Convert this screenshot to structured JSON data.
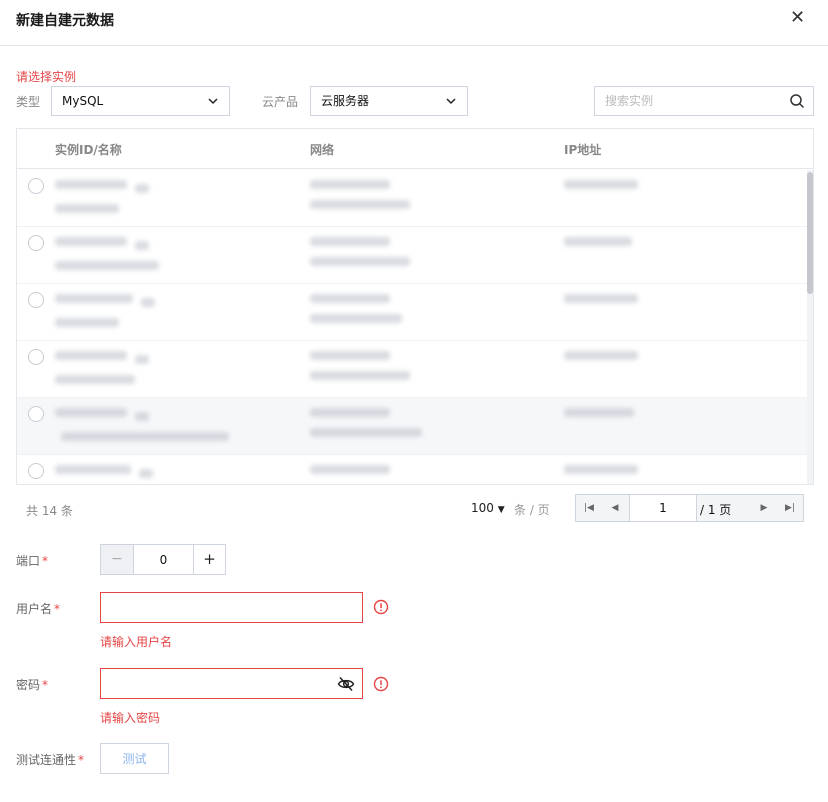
{
  "dialog": {
    "title": "新建自建元数据"
  },
  "filters": {
    "warning": "请选择实例",
    "type_label": "类型",
    "type_value": "MySQL",
    "product_label": "云产品",
    "product_value": "云服务器",
    "search_placeholder": "搜索实例"
  },
  "table": {
    "columns": [
      "实例ID/名称",
      "网络",
      "IP地址"
    ],
    "row_count_visible": 6
  },
  "pagination": {
    "total": "共 14 条",
    "page_size": "100",
    "page_size_unit": "条 / 页",
    "current_page": "1",
    "total_pages": "/ 1 页"
  },
  "form": {
    "port_label": "端口",
    "port_value": "0",
    "username_label": "用户名",
    "username_error": "请输入用户名",
    "password_label": "密码",
    "password_error": "请输入密码",
    "test_label": "测试连通性",
    "test_button": "测试",
    "required_mark": "*"
  },
  "colors": {
    "error": "#e54545",
    "border": "#cfd5de",
    "link": "#8bb4ea"
  }
}
